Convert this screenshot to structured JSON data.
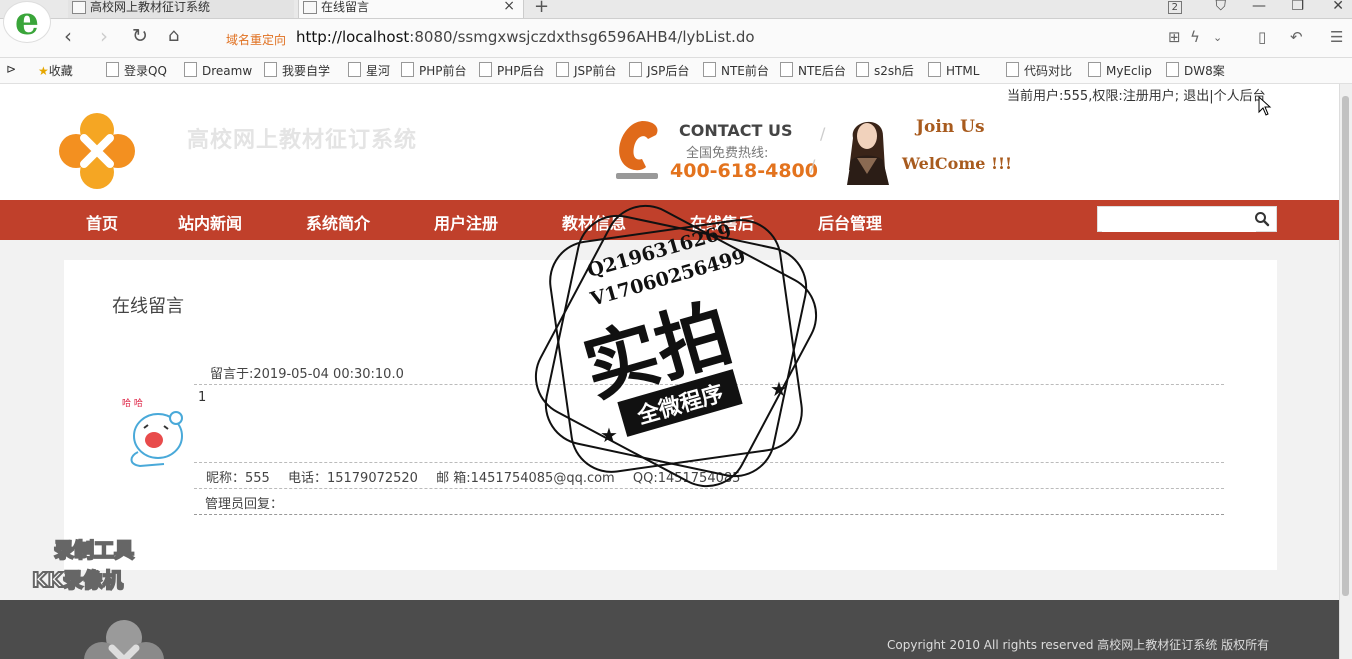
{
  "browser": {
    "tabs": [
      {
        "label": "高校网上教材征订系统"
      },
      {
        "label": "在线留言"
      }
    ],
    "tab_count_badge": "2",
    "redirect_label": "域名重定向",
    "url_host": "http://localhost",
    "url_rest": ":8080/ssmgxwsjczdxthsg6596AHB4/lybList.do",
    "bookmarks": [
      "收藏",
      "登录QQ",
      "Dreamw",
      "我要自学",
      "星河",
      "PHP前台",
      "PHP后台",
      "JSP前台",
      "JSP后台",
      "NTE前台",
      "NTE后台",
      "s2sh后",
      "HTML",
      "代码对比",
      "MyEclip",
      "DW8案"
    ]
  },
  "header": {
    "user_info": "当前用户:555,权限:注册用户; 退出|个人后台",
    "site_title": "高校网上教材征订系统",
    "contact_title": "CONTACT US",
    "contact_sub": "全国免费热线:",
    "contact_phone": "400-618-4800",
    "join_line1": "Join Us",
    "join_line2": "WelCome !!!"
  },
  "menu": {
    "items": [
      "首页",
      "站内新闻",
      "系统简介",
      "用户注册",
      "教材信息",
      "在线售后",
      "后台管理"
    ],
    "search_placeholder": ""
  },
  "content": {
    "title": "在线留言",
    "messages": [
      {
        "time": "留言于:2019-05-04 00:30:10.0",
        "body": "1",
        "nickname": "昵称：555",
        "phone": "电话：15179072520",
        "email": "邮 箱:1451754085@qq.com",
        "qq": "QQ:1451754085",
        "admin_reply": "管理员回复："
      }
    ]
  },
  "footer": {
    "copyright": "Copyright 2010 All rights reserved 高校网上教材征订系统 版权所有"
  },
  "overlay": {
    "stamp_line1": "Q2196316269",
    "stamp_line2": "V1706025649​9",
    "stamp_big": "实拍",
    "stamp_ribbon": "全微程序",
    "recorder_line1": "录制工具",
    "recorder_line2": "KK录像机"
  },
  "colors": {
    "menu_bg": "#c0402b",
    "phone_orange": "#e3731e",
    "footer_bg": "#4c4c4c"
  }
}
